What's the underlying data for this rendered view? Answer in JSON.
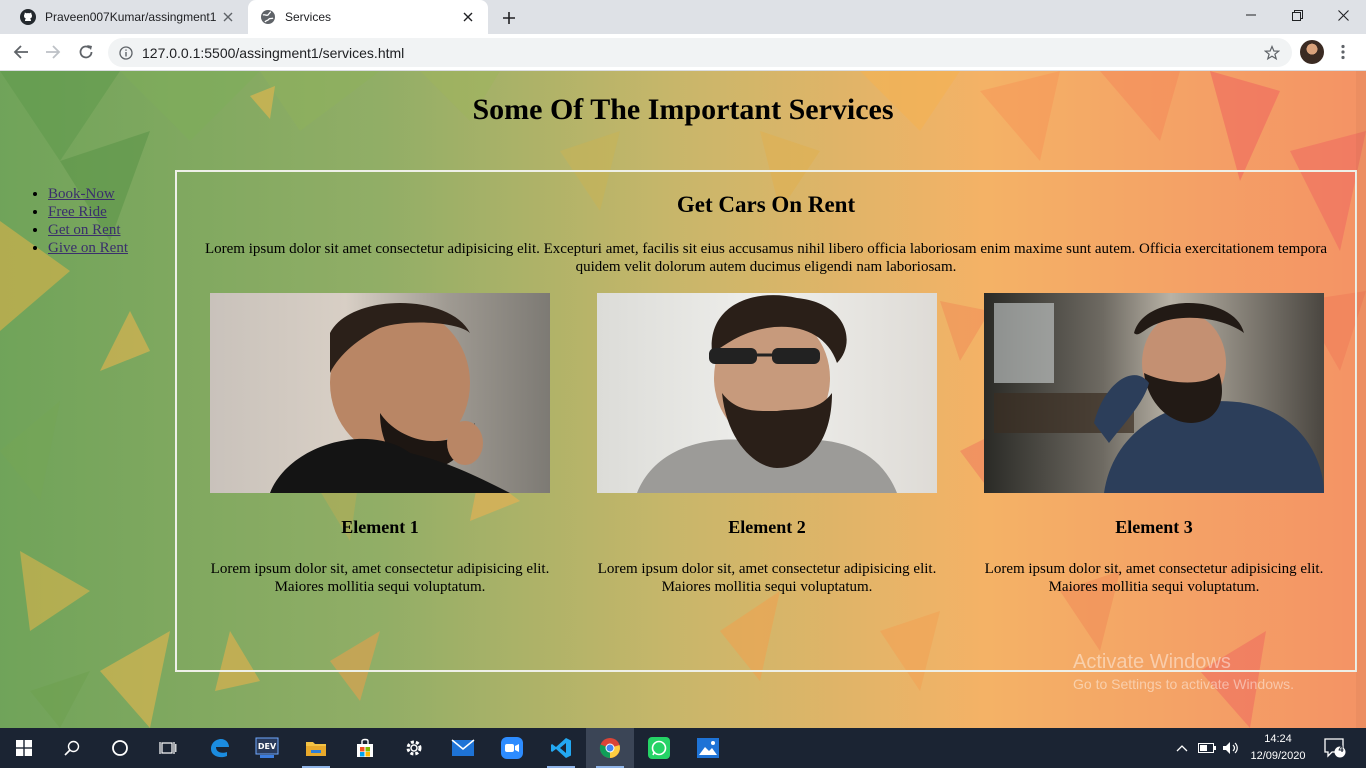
{
  "browser": {
    "tabs": [
      {
        "title": "Praveen007Kumar/assingment1",
        "icon": "github-icon",
        "active": false
      },
      {
        "title": "Services",
        "icon": "globe-icon",
        "active": true
      }
    ],
    "url": "127.0.0.1:5500/assingment1/services.html"
  },
  "page": {
    "title": "Some Of The Important Services",
    "nav": [
      {
        "label": "Book-Now"
      },
      {
        "label": "Free Ride"
      },
      {
        "label": "Get on Rent"
      },
      {
        "label": "Give on Rent"
      }
    ],
    "panel": {
      "heading": "Get Cars On Rent",
      "intro": "Lorem ipsum dolor sit amet consectetur adipisicing elit. Excepturi amet, facilis sit eius accusamus nihil libero officia laboriosam enim maxime sunt autem. Officia exercitationem tempora quidem velit dolorum autem ducimus eligendi nam laboriosam.",
      "cards": [
        {
          "title": "Element 1",
          "text": "Lorem ipsum dolor sit, amet consectetur adipisicing elit. Maiores mollitia sequi voluptatum."
        },
        {
          "title": "Element 2",
          "text": "Lorem ipsum dolor sit, amet consectetur adipisicing elit. Maiores mollitia sequi voluptatum."
        },
        {
          "title": "Element 3",
          "text": "Lorem ipsum dolor sit, amet consectetur adipisicing elit. Maiores mollitia sequi voluptatum."
        }
      ]
    }
  },
  "watermark": {
    "line1": "Activate Windows",
    "line2": "Go to Settings to activate Windows."
  },
  "taskbar": {
    "apps": [
      "windows-start-icon",
      "search-icon",
      "cortana-icon",
      "task-view-icon",
      "edge-icon",
      "dev-icon",
      "file-explorer-icon",
      "store-icon",
      "settings-icon",
      "mail-icon",
      "zoom-icon",
      "vscode-icon",
      "chrome-icon",
      "whatsapp-icon",
      "photos-icon"
    ],
    "time": "14:24",
    "date": "12/09/2020",
    "notifications": "4"
  },
  "colors": {
    "link": "#3a2f6b",
    "bg_green": "#6aa052",
    "bg_orange": "#f68c5a",
    "taskbar": "#1b2433"
  }
}
